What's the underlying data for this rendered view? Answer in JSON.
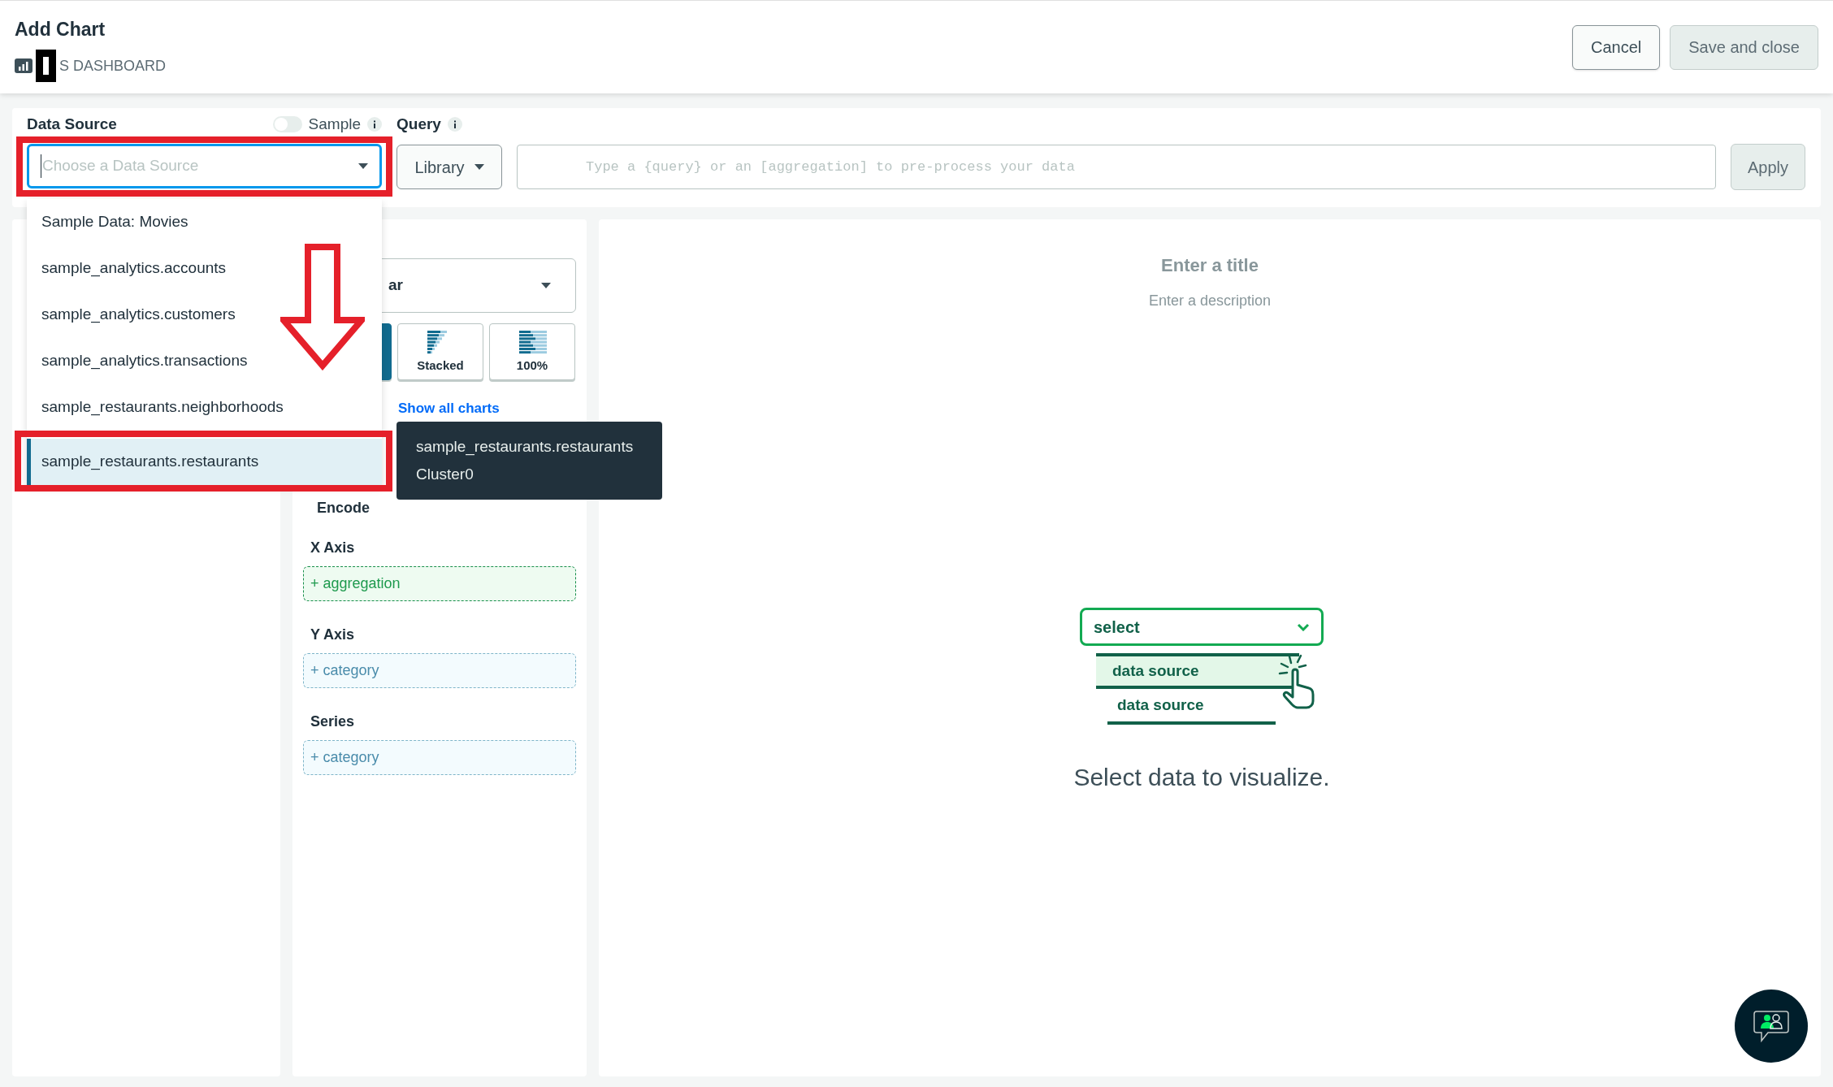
{
  "header": {
    "title": "Add Chart",
    "subtitle": "S DASHBOARD"
  },
  "buttons": [
    {
      "label": "Cancel",
      "disabled": false
    },
    {
      "label": "Save and close",
      "disabled": true
    }
  ],
  "data_source": {
    "label": "Data Source",
    "sample": {
      "label": "Sample",
      "on": false
    },
    "select": {
      "placeholder": "Choose a Data Source"
    },
    "options": [
      {
        "label": "Sample Data: Movies",
        "selected": false
      },
      {
        "label": "sample_analytics.accounts",
        "selected": false
      },
      {
        "label": "sample_analytics.customers",
        "selected": false
      },
      {
        "label": "sample_analytics.transactions",
        "selected": false
      },
      {
        "label": "sample_restaurants.neighborhoods",
        "selected": false
      },
      {
        "label": "sample_restaurants.restaurants",
        "selected": true
      }
    ],
    "tooltip": [
      "sample_restaurants.restaurants",
      "Cluster0"
    ]
  },
  "query": {
    "label": "Query",
    "library": "Library",
    "placeholder": "Type a {query} or an [aggregation] to pre-process your data",
    "apply": "Apply"
  },
  "chart_type": {
    "value": "ar",
    "variants": [
      {
        "selected": true
      },
      {
        "label": "Stacked",
        "selected": false
      },
      {
        "label": "100%",
        "selected": false
      }
    ],
    "show_all": "Show all charts"
  },
  "encode": {
    "label": "Encode",
    "channels": [
      {
        "name": "X Axis",
        "placeholder": "+ aggregation",
        "kind": "aggregation"
      },
      {
        "name": "Y Axis",
        "placeholder": "+ category",
        "kind": "category"
      },
      {
        "name": "Series",
        "placeholder": "+ category",
        "kind": "category"
      }
    ]
  },
  "canvas": {
    "title": "Enter a title",
    "description": "Enter a description",
    "illustration": {
      "select": "select",
      "items": [
        "data source",
        "data source"
      ]
    },
    "message": "Select data to visualize."
  }
}
